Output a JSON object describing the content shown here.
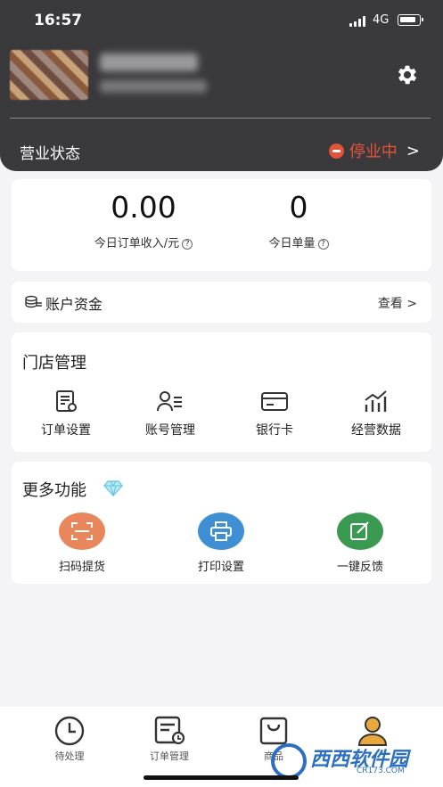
{
  "status_bar": {
    "time": "16:57",
    "network": "4G"
  },
  "header": {
    "business_status_label": "营业状态",
    "business_status_value": "停业中"
  },
  "stats": {
    "income_value": "0.00",
    "income_label": "今日订单收入/元",
    "orders_value": "0",
    "orders_label": "今日单量"
  },
  "funds": {
    "label": "账户资金",
    "view": "查看"
  },
  "store_management": {
    "title": "门店管理",
    "items": [
      {
        "label": "订单设置",
        "icon": "order-settings-icon"
      },
      {
        "label": "账号管理",
        "icon": "account-manage-icon"
      },
      {
        "label": "银行卡",
        "icon": "bank-card-icon"
      },
      {
        "label": "经营数据",
        "icon": "business-data-icon"
      }
    ]
  },
  "more_functions": {
    "title": "更多功能",
    "items": [
      {
        "label": "扫码提货",
        "icon": "scan-icon",
        "color": "#e8875c"
      },
      {
        "label": "打印设置",
        "icon": "printer-icon",
        "color": "#3e8fd4"
      },
      {
        "label": "一键反馈",
        "icon": "feedback-icon",
        "color": "#3a9a52"
      }
    ]
  },
  "tabbar": {
    "items": [
      {
        "label": "待处理",
        "icon": "clock-icon"
      },
      {
        "label": "订单管理",
        "icon": "order-manage-icon"
      },
      {
        "label": "商品",
        "icon": "bag-icon"
      },
      {
        "label": "",
        "icon": "user-icon"
      }
    ]
  },
  "watermark": {
    "text": "西西软件园",
    "sub": "CR173.COM"
  },
  "colors": {
    "accent_red": "#e2533a",
    "header_bg": "#3a3a3c",
    "user_tab": "#e8a93c"
  }
}
